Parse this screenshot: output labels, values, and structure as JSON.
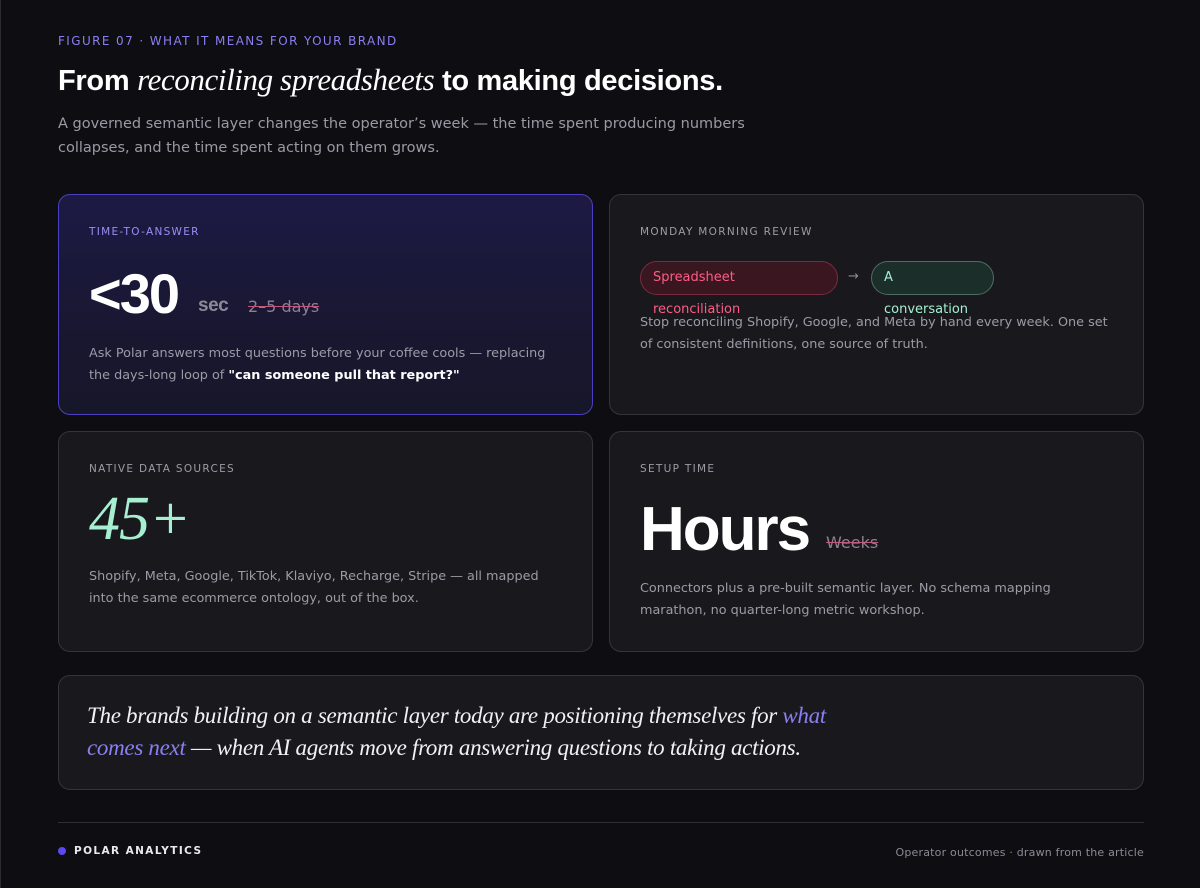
{
  "header": {
    "eyebrow": "FIGURE 07 · WHAT IT MEANS FOR YOUR BRAND",
    "title_pre": "From ",
    "title_italic": "reconciling spreadsheets",
    "title_post": " to making decisions.",
    "subtitle": "A governed semantic layer changes the operator’s week — the time spent producing numbers collapses, and the time spent acting on them grows."
  },
  "cards": {
    "time_to_answer": {
      "label": "TIME-TO-ANSWER",
      "value": "<30",
      "unit": "sec",
      "old_value": "2–5 days",
      "body_pre": "Ask Polar answers most questions before your coffee cools — replacing the days-long loop of ",
      "body_bold": "\"can someone pull that report?\""
    },
    "monday_review": {
      "label": "MONDAY MORNING REVIEW",
      "from_pill": "Spreadsheet reconciliation",
      "arrow": "→",
      "to_pill": "A conversation",
      "body": "Stop reconciling Shopify, Google, and Meta by hand every week. One set of consistent definitions, one source of truth."
    },
    "data_sources": {
      "label": "NATIVE DATA SOURCES",
      "value": "45+",
      "body": "Shopify, Meta, Google, TikTok, Klaviyo, Recharge, Stripe — all mapped into the same ecommerce ontology, out of the box."
    },
    "setup_time": {
      "label": "SETUP TIME",
      "value": "Hours",
      "old_value": "Weeks",
      "body": "Connectors plus a pre-built semantic layer. No schema mapping marathon, no quarter-long metric workshop."
    }
  },
  "quote": {
    "pre": "The brands building on a semantic layer today are positioning themselves for ",
    "highlight": "what comes next",
    "post": " — when AI agents move from answering questions to taking actions."
  },
  "footer": {
    "brand": "POLAR ANALYTICS",
    "note": "Operator outcomes · drawn from the article"
  },
  "colors": {
    "accent": "#8a7ff0",
    "mint": "#a6efd1",
    "red": "#ff5c86",
    "brand_dot": "#5a48f0"
  }
}
